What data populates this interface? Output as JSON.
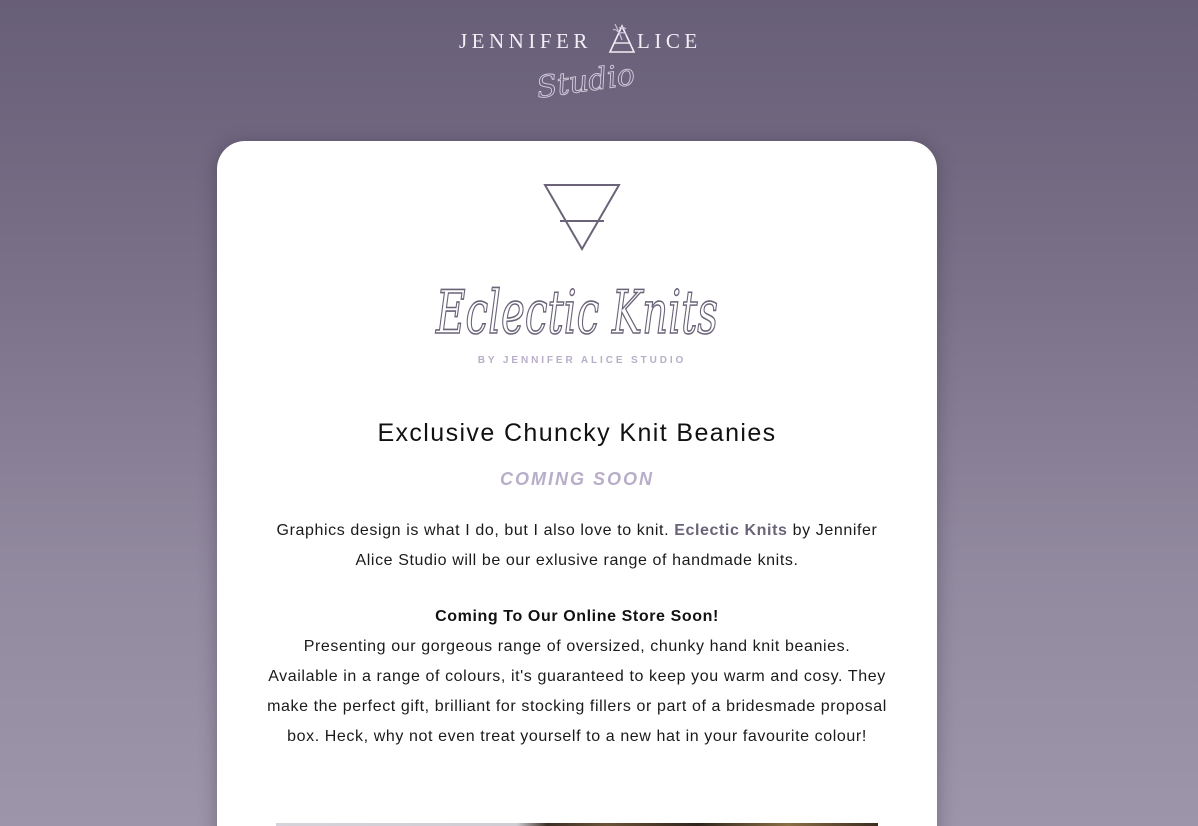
{
  "header": {
    "logo_text_left": "JENNIFER",
    "logo_text_right": "LICE",
    "logo_script": "Studio"
  },
  "brand_logo": {
    "script": "Eclectic Knits",
    "tagline": "BY JENNIFER ALICE STUDIO"
  },
  "content": {
    "headline": "Exclusive Chuncky Knit Beanies",
    "coming_soon": "COMING SOON",
    "intro_before": "Graphics design is what I do, but I also love to knit.",
    "intro_brand": "Eclectic Knits",
    "intro_after": "by Jennifer Alice Studio will be our exlusive range of handmade knits.",
    "store_heading": "Coming To Our Online Store Soon!",
    "store_text": "Presenting our gorgeous range of oversized, chunky hand knit beanies. Available in a range of colours, it's guaranteed to keep you warm and cosy. They make the perfect gift, brilliant for stocking fillers or part of a bridesmade proposal box. Heck, why not even treat yourself to a new hat in your favourite colour!"
  },
  "colors": {
    "background_top": "#675e77",
    "background_bottom": "#9d95a9",
    "card": "#ffffff",
    "accent_lilac": "#b8aec9",
    "brand_grey_purple": "#6b6378"
  }
}
